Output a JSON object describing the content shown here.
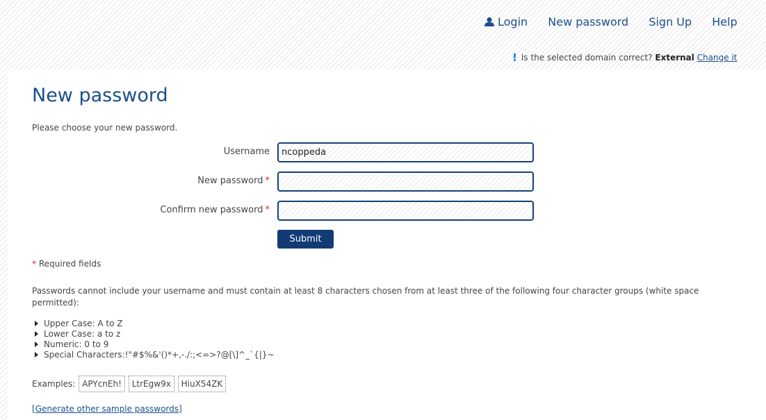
{
  "nav": {
    "login": "Login",
    "new_password": "New password",
    "sign_up": "Sign Up",
    "help": "Help"
  },
  "domain_notice": {
    "icon": "!",
    "question": "Is the selected domain correct?",
    "domain": "External",
    "change_link": "Change it"
  },
  "page": {
    "title": "New password",
    "intro": "Please choose your new password."
  },
  "form": {
    "username_label": "Username",
    "username_value": "ncoppeda",
    "new_password_label": "New password",
    "confirm_password_label": "Confirm new password",
    "required_marker": "*",
    "submit_label": "Submit"
  },
  "required_note": {
    "marker": "*",
    "text": "Required fields"
  },
  "policy": {
    "text": "Passwords cannot include your username and must contain at least 8 characters chosen from at least three of the following four character groups (white space permitted):",
    "rules": [
      "Upper Case: A to Z",
      "Lower Case: a to z",
      "Numeric: 0 to 9",
      "Special Characters:!\"#$%&'()*+,-./:;<=>?@[\\]^_`{|}~"
    ]
  },
  "examples": {
    "label": "Examples:",
    "items": [
      "APYcnEh!",
      "LtrEgw9x",
      "HiuX54ZK"
    ]
  },
  "generate": {
    "open": "[",
    "link": "Generate other sample passwords",
    "close": "]"
  },
  "colors": {
    "accent": "#1b4f8c",
    "button": "#123a75",
    "required": "#d9261c",
    "notice_icon": "#1a73e8"
  }
}
